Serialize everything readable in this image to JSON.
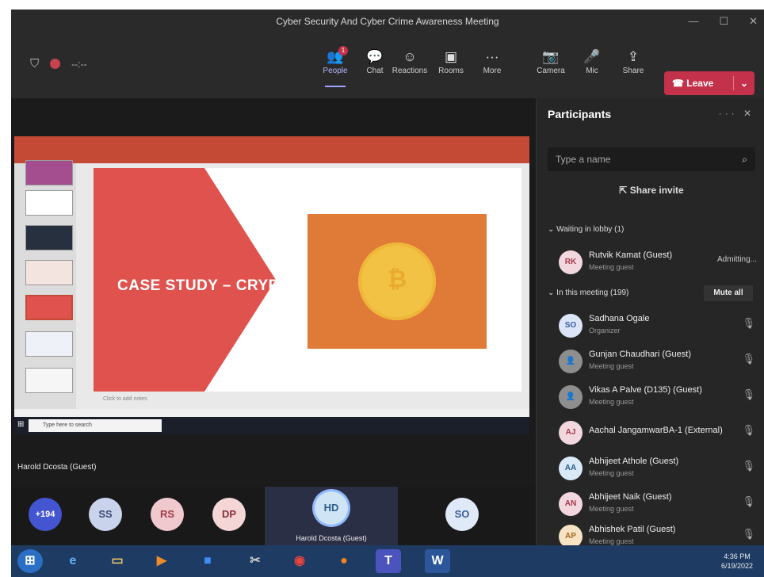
{
  "window": {
    "title": "Cyber Security And Cyber Crime Awareness Meeting"
  },
  "toolbar": {
    "people_label": "People",
    "people_badge": "1",
    "chat_label": "Chat",
    "reactions_label": "Reactions",
    "rooms_label": "Rooms",
    "more_label": "More",
    "camera_label": "Camera",
    "mic_label": "Mic",
    "share_label": "Share",
    "leave_label": "Leave",
    "timer": "--:--"
  },
  "colors": {
    "accent": "#9ea2ff",
    "leave": "#c4314b",
    "slide_red": "#e0524d",
    "slide_orange": "#e07a37",
    "coin": "#f2c244"
  },
  "slide": {
    "title": "CASE STUDY – CRYPTO",
    "notes_placeholder": "Click to add notes",
    "inner_search": "Type here to search"
  },
  "presenter_label": "Harold Dcosta (Guest)",
  "strip": {
    "overflow": "+194",
    "avatars": [
      "SS",
      "RS",
      "DP"
    ],
    "active_initials": "HD",
    "active_name": "Harold Dcosta (Guest)",
    "last_initials": "SO"
  },
  "panel": {
    "title": "Participants",
    "search_placeholder": "Type a name",
    "share_invite": "Share invite",
    "lobby_header": "Waiting in lobby (1)",
    "lobby": {
      "initials": "RK",
      "name": "Rutvik Kamat (Guest)",
      "sub": "Meeting guest",
      "status": "Admitting..."
    },
    "meeting_header": "In this meeting (199)",
    "mute_all": "Mute all",
    "people": [
      {
        "initials": "SO",
        "name": "Sadhana Ogale",
        "sub": "Organizer"
      },
      {
        "initials": "",
        "name": "Gunjan Chaudhari (Guest)",
        "sub": "Meeting guest"
      },
      {
        "initials": "",
        "name": "Vikas A Palve (D135) (Guest)",
        "sub": "Meeting guest"
      },
      {
        "initials": "AJ",
        "name": "Aachal JangamwarBA-1 (External)",
        "sub": ""
      },
      {
        "initials": "AA",
        "name": "Abhijeet Athole (Guest)",
        "sub": "Meeting guest"
      },
      {
        "initials": "AN",
        "name": "Abhijeet Naik (Guest)",
        "sub": "Meeting guest"
      },
      {
        "initials": "AP",
        "name": "Abhishek Patil (Guest)",
        "sub": "Meeting guest"
      }
    ]
  },
  "clock": {
    "time": "4:36 PM",
    "date": "6/19/2022"
  }
}
